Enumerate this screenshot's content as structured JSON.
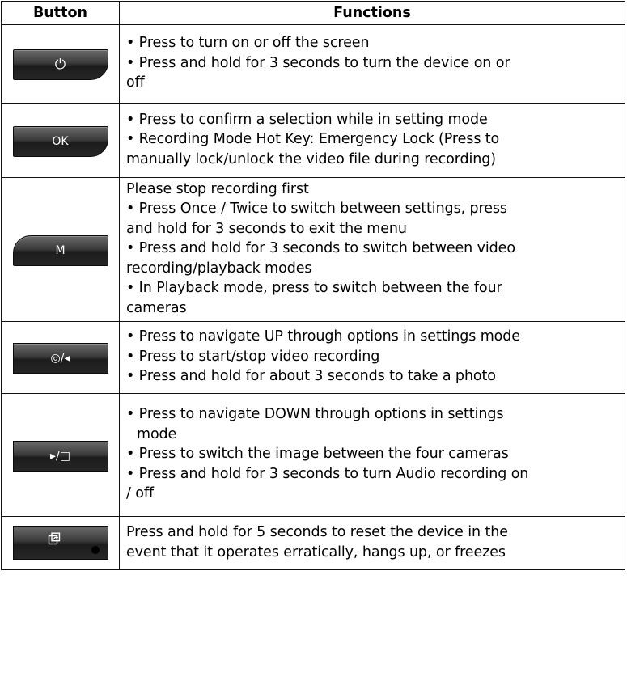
{
  "table": {
    "headers": {
      "button": "Button",
      "functions": "Functions"
    },
    "rows": [
      {
        "button_label": "⏻",
        "button_icon": "power-icon",
        "lines": [
          "• Press to turn on or off the screen",
          "• Press and hold for 3 seconds to turn the device on or",
          "off"
        ]
      },
      {
        "button_label": "OK",
        "lines": [
          "• Press to confirm a selection while in setting mode",
          "• Recording Mode Hot Key: Emergency Lock (Press to",
          "manually lock/unlock the video file during recording)"
        ]
      },
      {
        "button_label": "M",
        "lines": [
          "Please stop recording first",
          "• Press Once / Twice to switch between settings, press",
          "and hold for 3 seconds to exit the menu",
          "• Press and hold for 3 seconds to switch between video",
          "recording/playback modes",
          "• In Playback mode, press to switch between the four",
          "cameras"
        ]
      },
      {
        "button_label": "◎/◂",
        "button_icon": "record-up-icon",
        "lines": [
          "• Press to navigate UP through options in settings mode",
          "• Press to start/stop video recording",
          "• Press and hold for about 3 seconds to take a photo"
        ]
      },
      {
        "button_label": "▸/□",
        "button_icon": "playback-down-icon",
        "lines": [
          "• Press to navigate DOWN through options in settings",
          "mode",
          "• Press to switch the image between the four cameras",
          "• Press and hold for 3 seconds to turn Audio recording on",
          "/ off"
        ]
      },
      {
        "button_icon": "reset-icon",
        "lines": [
          "Press and hold for 5 seconds to reset the device in the",
          "event that it operates erratically, hangs up, or freezes"
        ]
      }
    ]
  }
}
